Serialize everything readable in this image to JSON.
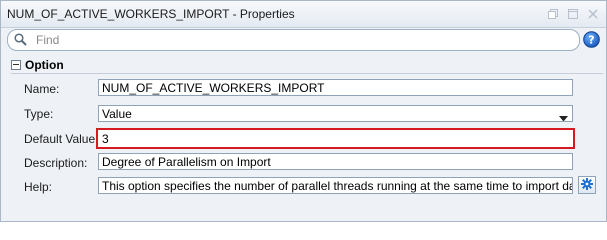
{
  "window": {
    "title": "NUM_OF_ACTIVE_WORKERS_IMPORT - Properties",
    "buttons": [
      "restore-icon",
      "maximize-icon",
      "close-icon"
    ]
  },
  "search": {
    "placeholder": "Find",
    "value": ""
  },
  "help_icon": "help-icon",
  "section": {
    "title": "Option",
    "expanded": true
  },
  "fields": {
    "name": {
      "label": "Name:",
      "value": "NUM_OF_ACTIVE_WORKERS_IMPORT"
    },
    "type": {
      "label": "Type:",
      "value": "Value"
    },
    "default_value": {
      "label": "Default Value:",
      "value": "3"
    },
    "description": {
      "label": "Description:",
      "value": "Degree of Parallelism on Import"
    },
    "help": {
      "label": "Help:",
      "value": "This option specifies the number of parallel threads running at the same time to import data from th"
    }
  },
  "colors": {
    "highlight": "#d61a22",
    "accent": "#1e6fcf"
  }
}
